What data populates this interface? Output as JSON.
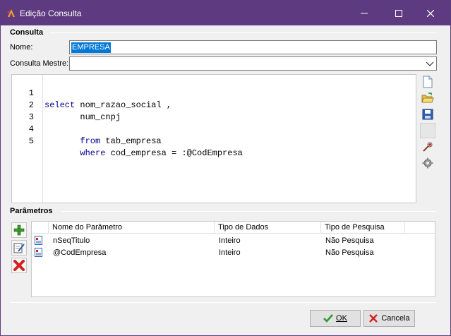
{
  "window": {
    "title": "Edição Consulta",
    "controls": {
      "minimize": "—",
      "maximize": "☐",
      "close": "✕"
    }
  },
  "consulta": {
    "section_label": "Consulta",
    "name_label": "Nome:",
    "name_value": "EMPRESA",
    "master_label": "Consulta Mestre:",
    "master_value": ""
  },
  "editor": {
    "lines": [
      {
        "num": "1",
        "kw": "select",
        "rest": " nom_razao_social ,"
      },
      {
        "num": "2",
        "kw": "",
        "rest": "       num_cnpj"
      },
      {
        "num": "3",
        "kw": "",
        "rest": ""
      },
      {
        "num": "4",
        "kw": "       from",
        "rest": " tab_empresa"
      },
      {
        "num": "5",
        "kw": "       where",
        "rest": " cod_empresa = :@CodEmpresa"
      }
    ]
  },
  "side_tools": [
    "new-document-icon",
    "open-folder-icon",
    "save-disk-icon",
    "blank",
    "magic-wand-icon",
    "gear-icon"
  ],
  "parametros": {
    "section_label": "Parâmetros",
    "columns": [
      "Nome do Parâmetro",
      "Tipo de Dados",
      "Tipo de Pesquisa"
    ],
    "rows": [
      {
        "nome": "nSeqTitulo",
        "tipo_dados": "Inteiro",
        "tipo_pesquisa": "Não Pesquisa"
      },
      {
        "nome": "@CodEmpresa",
        "tipo_dados": "Inteiro",
        "tipo_pesquisa": "Não Pesquisa"
      }
    ],
    "buttons": [
      "add-icon",
      "edit-icon",
      "delete-icon"
    ]
  },
  "footer": {
    "ok_label": "OK",
    "cancel_label": "Cancela"
  },
  "colors": {
    "titlebar": "#5e3a80",
    "selection": "#0078d7",
    "keyword": "#00008b",
    "dialog_bg": "#f0f0f0"
  }
}
